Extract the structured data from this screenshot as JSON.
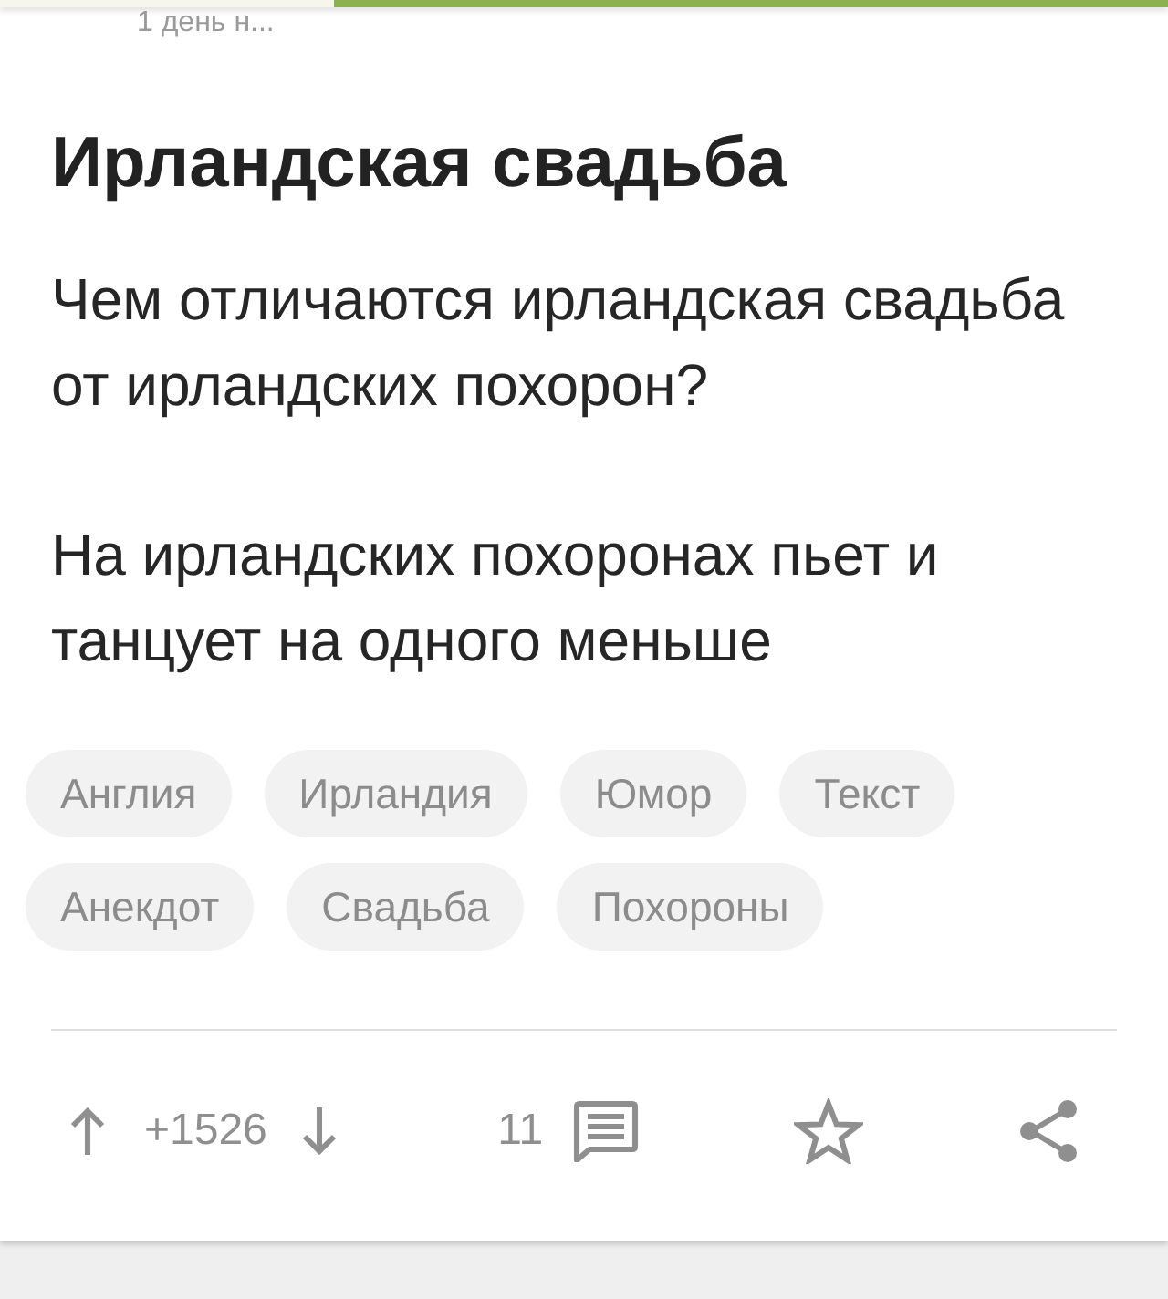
{
  "top_bar": {
    "time_text": "1 день н..."
  },
  "post": {
    "title": "Ирландская свадьба",
    "paragraphs": [
      "Чем отличаются ирландская свадьба от ирландских похорон?",
      "На ирландских похоронах пьет и танцует на одного меньше"
    ],
    "tags": [
      "Англия",
      "Ирландия",
      "Юмор",
      "Текст",
      "Анекдот",
      "Свадьба",
      "Похороны"
    ],
    "actions": {
      "rating": "+1526",
      "comments_count": "11"
    }
  }
}
